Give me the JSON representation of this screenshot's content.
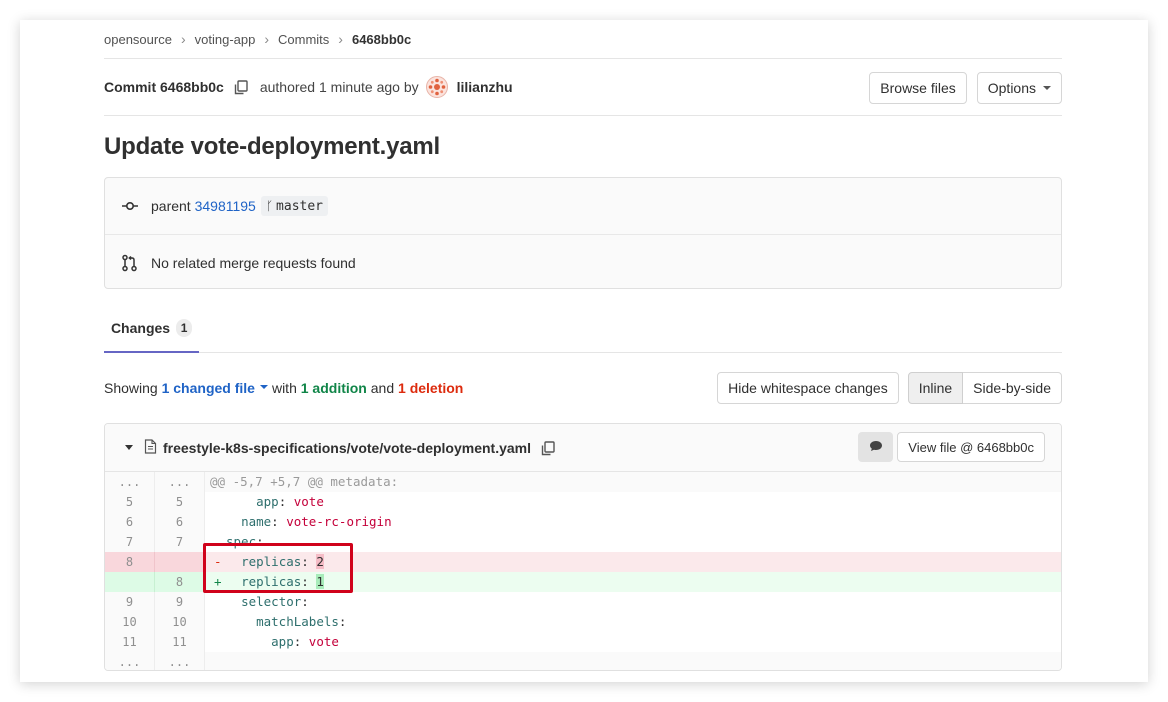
{
  "breadcrumb": [
    "opensource",
    "voting-app",
    "Commits",
    "6468bb0c"
  ],
  "commit": {
    "label": "Commit 6468bb0c",
    "authored": "authored 1 minute ago by",
    "author": "lilianzhu",
    "browse_files": "Browse files",
    "options": "Options"
  },
  "title": "Update vote-deployment.yaml",
  "info": {
    "parent_label": "parent",
    "parent_sha": "34981195",
    "branch": "master",
    "merge_requests": "No related merge requests found"
  },
  "tabs": [
    {
      "label": "Changes",
      "count": "1"
    }
  ],
  "showing": {
    "prefix": "Showing",
    "changed_files": "1 changed file",
    "with": "with",
    "additions": "1 addition",
    "and": "and",
    "deletions": "1 deletion",
    "hide_whitespace": "Hide whitespace changes",
    "inline": "Inline",
    "side_by_side": "Side-by-side"
  },
  "diff": {
    "file_path": "freestyle-k8s-specifications/vote/vote-deployment.yaml",
    "view_file": "View file @ 6468bb0c",
    "lines": [
      {
        "type": "meta",
        "old": "...",
        "new": "...",
        "text": "@@ -5,7 +5,7 @@ metadata:"
      },
      {
        "type": "ctx",
        "old": "5",
        "new": "5",
        "indent": "    ",
        "key": "app",
        "value": "vote"
      },
      {
        "type": "ctx",
        "old": "6",
        "new": "6",
        "indent": "  ",
        "key": "name",
        "value": "vote-rc-origin"
      },
      {
        "type": "ctx",
        "old": "7",
        "new": "7",
        "indent": "",
        "key": "spec",
        "value": ""
      },
      {
        "type": "del",
        "old": "8",
        "new": "",
        "sign": "-",
        "indent": "  ",
        "key": "replicas",
        "value": "2"
      },
      {
        "type": "add",
        "old": "",
        "new": "8",
        "sign": "+",
        "indent": "  ",
        "key": "replicas",
        "value": "1"
      },
      {
        "type": "ctx",
        "old": "9",
        "new": "9",
        "indent": "  ",
        "key": "selector",
        "value": ""
      },
      {
        "type": "ctx",
        "old": "10",
        "new": "10",
        "indent": "    ",
        "key": "matchLabels",
        "value": ""
      },
      {
        "type": "ctx",
        "old": "11",
        "new": "11",
        "indent": "      ",
        "key": "app",
        "value": "vote"
      },
      {
        "type": "meta",
        "old": "...",
        "new": "...",
        "text": ""
      }
    ]
  },
  "colors": {
    "link": "#1f63c6",
    "addition": "#108548",
    "deletion": "#dd2b0e",
    "tab_underline": "#6666c4",
    "annotation": "#d0021b"
  }
}
